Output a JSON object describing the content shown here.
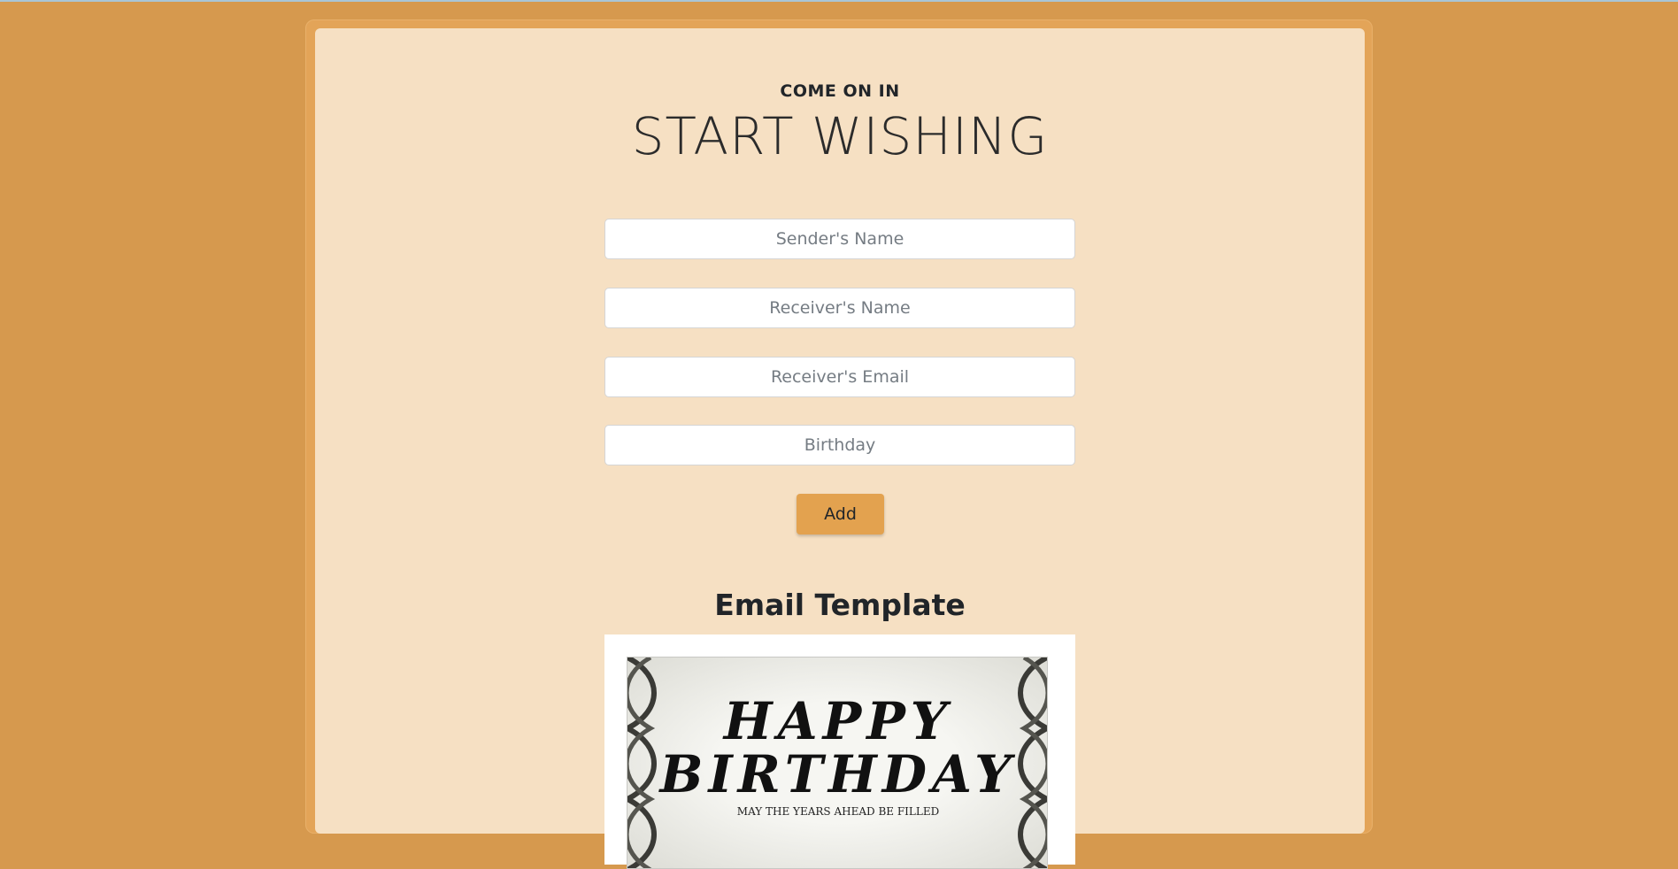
{
  "header": {
    "eyebrow": "COME ON IN",
    "title": "START WISHING"
  },
  "form": {
    "sender_placeholder": "Sender's Name",
    "receiver_placeholder": "Receiver's Name",
    "email_placeholder": "Receiver's Email",
    "birthday_placeholder": "Birthday",
    "add_label": "Add"
  },
  "template": {
    "title": "Email Template",
    "card_line_1": "HAPPY",
    "card_line_2": "BIRTHDAY",
    "card_subtext": "MAY THE YEARS AHEAD BE FILLED"
  },
  "colors": {
    "background": "#d6994e",
    "panel": "#f6e0c3",
    "accent_button": "#e3a24f"
  }
}
